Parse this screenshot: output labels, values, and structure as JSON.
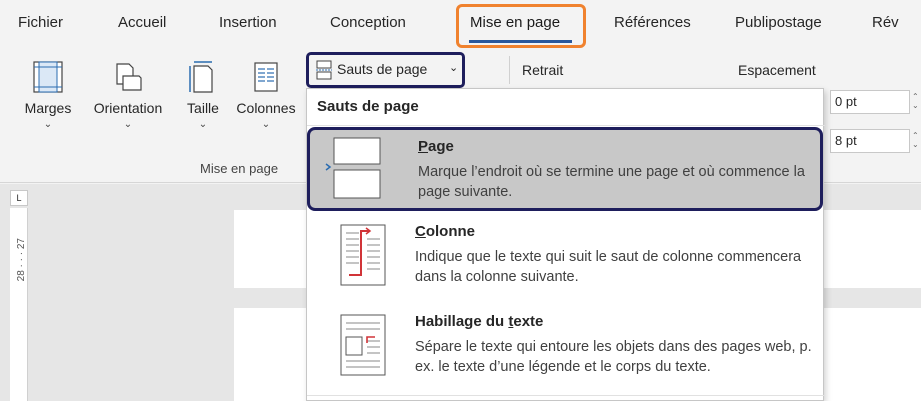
{
  "tabs": [
    {
      "label": "Fichier"
    },
    {
      "label": "Accueil"
    },
    {
      "label": "Insertion"
    },
    {
      "label": "Conception"
    },
    {
      "label": "Mise en page"
    },
    {
      "label": "Références"
    },
    {
      "label": "Publipostage"
    },
    {
      "label": "Rév"
    }
  ],
  "ribbon": {
    "marges": "Marges",
    "orientation": "Orientation",
    "taille": "Taille",
    "colonnes": "Colonnes",
    "group_label": "Mise en page",
    "sauts_label": "Sauts de page",
    "retrait": "Retrait",
    "espacement": "Espacement",
    "spacing_before": "0 pt",
    "spacing_after": "8 pt"
  },
  "ruler": {
    "text": "28 · · · 27"
  },
  "menu": {
    "header": "Sauts de page",
    "items": [
      {
        "title_pre": "",
        "title_ul": "P",
        "title_post": "age",
        "desc": "Marque l’endroit où se termine une page et où commence la page suivante."
      },
      {
        "title_pre": "",
        "title_ul": "C",
        "title_post": "olonne",
        "desc": "Indique que le texte qui suit le saut de colonne commencera dans la colonne suivante."
      },
      {
        "title_pre": "Habillage du ",
        "title_ul": "t",
        "title_post": "exte",
        "desc": "Sépare le texte qui entoure les objets dans des pages web, p. ex. le texte d’une légende et le corps du texte."
      }
    ]
  },
  "colors": {
    "accent": "#2b579a",
    "highlight_orange": "#f0822e",
    "highlight_navy": "#1e1e5c",
    "red_icon": "#d13438"
  }
}
